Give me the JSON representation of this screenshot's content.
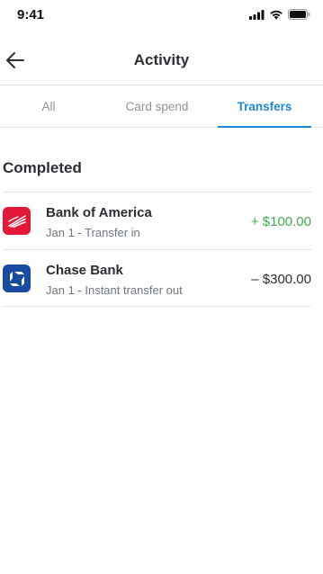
{
  "status_bar": {
    "time": "9:41",
    "icons": [
      "signal-icon",
      "wifi-icon",
      "battery-icon"
    ]
  },
  "header": {
    "title": "Activity",
    "back_icon": "arrow-left-icon"
  },
  "tabs": [
    {
      "label": "All",
      "active": false
    },
    {
      "label": "Card spend",
      "active": false
    },
    {
      "label": "Transfers",
      "active": true
    }
  ],
  "section": {
    "title": "Completed"
  },
  "transactions": [
    {
      "name": "Bank of America",
      "subtitle": "Jan 1 - Transfer in",
      "amount": "+ $100.00",
      "amount_color": "#3fae4a",
      "logo": "bank-of-america-logo",
      "logo_color": "#e31837"
    },
    {
      "name": "Chase Bank",
      "subtitle": "Jan 1 - Instant transfer out",
      "amount": "– $300.00",
      "amount_color": "#2b2f33",
      "logo": "chase-logo",
      "logo_color": "#1a4ba3"
    }
  ],
  "colors": {
    "accent": "#1e88d6",
    "positive": "#3fae4a",
    "divider": "#e3e5e8"
  }
}
